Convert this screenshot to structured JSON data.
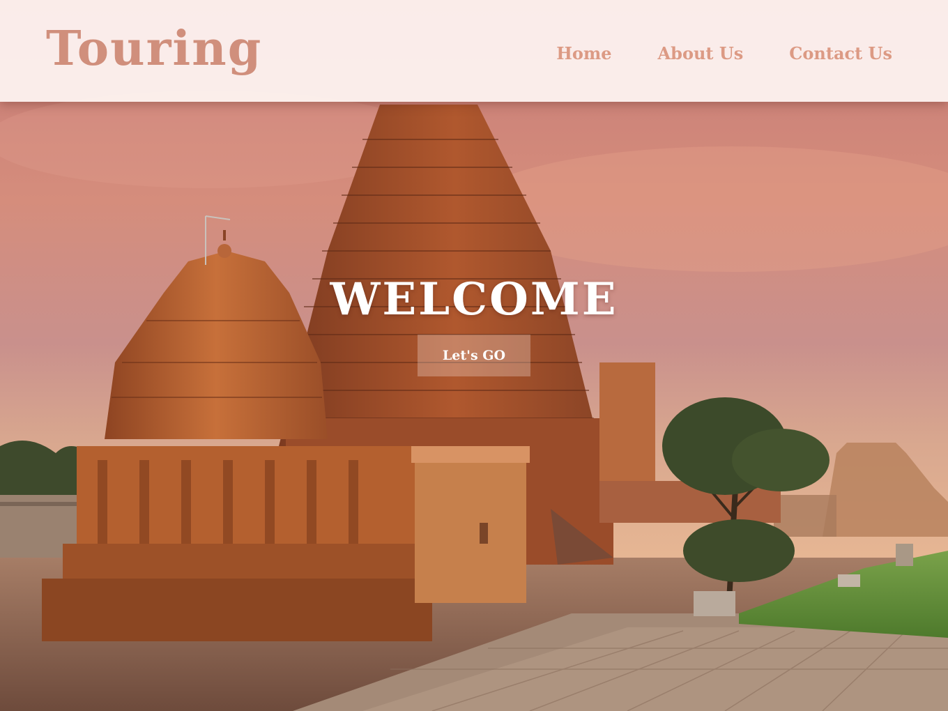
{
  "header": {
    "brand": "Touring",
    "nav": [
      {
        "label": "Home"
      },
      {
        "label": "About Us"
      },
      {
        "label": "Contact Us"
      }
    ]
  },
  "hero": {
    "title": "WELCOME",
    "cta_label": "Let's GO"
  },
  "colors": {
    "brand": "#d08f7c",
    "nav_link": "#dc9a84",
    "hero_text": "#ffffff"
  }
}
